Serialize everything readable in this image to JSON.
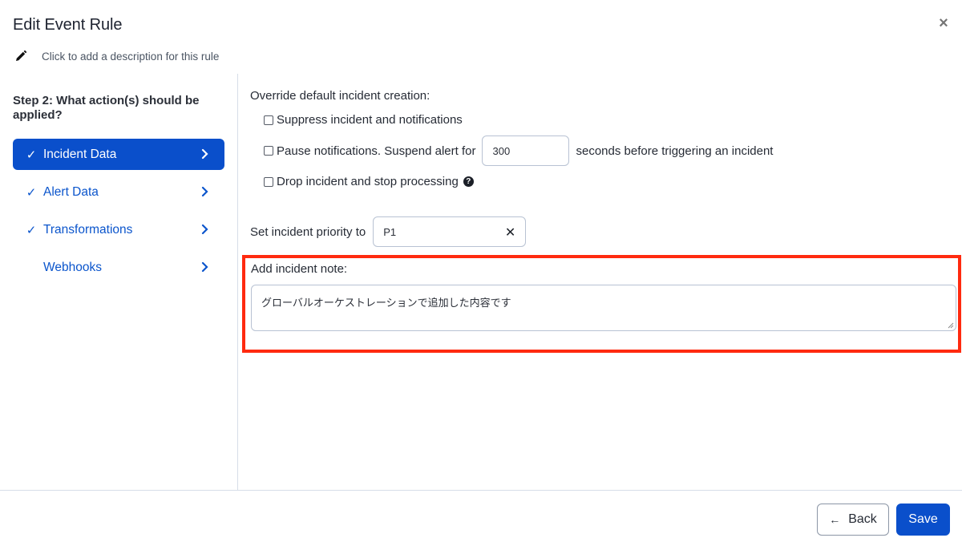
{
  "dialog": {
    "title": "Edit Event Rule",
    "description_placeholder": "Click to add a description for this rule",
    "close_icon": "close-icon"
  },
  "sidebar": {
    "step_title": "Step 2: What action(s) should be applied?",
    "items": [
      {
        "label": "Incident Data",
        "checked": true,
        "active": true,
        "check_glyph": "✓"
      },
      {
        "label": "Alert Data",
        "checked": true,
        "active": false,
        "check_glyph": "✓"
      },
      {
        "label": "Transformations",
        "checked": true,
        "active": false,
        "check_glyph": "✓"
      },
      {
        "label": "Webhooks",
        "checked": false,
        "active": false,
        "check_glyph": ""
      }
    ]
  },
  "content": {
    "override_label": "Override default incident creation:",
    "options": {
      "suppress": {
        "label": "Suppress incident and notifications",
        "checked": false
      },
      "pause": {
        "label_before": "Pause notifications. Suspend alert for",
        "value": "300",
        "label_after": "seconds before triggering an incident",
        "checked": false
      },
      "drop": {
        "label": "Drop incident and stop processing",
        "checked": false,
        "help_glyph": "?"
      }
    },
    "priority": {
      "label": "Set incident priority to",
      "value": "P1",
      "clear_glyph": "✕"
    },
    "note": {
      "label": "Add incident note:",
      "value": "グローバルオーケストレーションで追加した内容です"
    }
  },
  "footer": {
    "back_label": "Back",
    "back_arrow": "←",
    "save_label": "Save"
  },
  "colors": {
    "primary": "#0a4fcb",
    "highlight_border": "#ff2a0f",
    "divider": "#d6dde8"
  }
}
